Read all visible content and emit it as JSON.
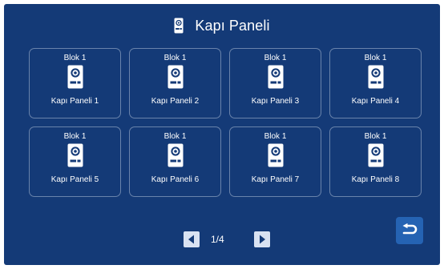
{
  "header": {
    "title": "Kapı Paneli",
    "icon": "door-panel-icon"
  },
  "tiles": [
    {
      "block": "Blok 1",
      "name": "Kapı Paneli 1",
      "icon": "door-panel-icon"
    },
    {
      "block": "Blok 1",
      "name": "Kapı Paneli 2",
      "icon": "door-panel-icon"
    },
    {
      "block": "Blok 1",
      "name": "Kapı Paneli 3",
      "icon": "door-panel-icon"
    },
    {
      "block": "Blok 1",
      "name": "Kapı Paneli 4",
      "icon": "door-panel-icon"
    },
    {
      "block": "Blok 1",
      "name": "Kapı Paneli 5",
      "icon": "door-panel-icon"
    },
    {
      "block": "Blok 1",
      "name": "Kapı Paneli 6",
      "icon": "door-panel-icon"
    },
    {
      "block": "Blok 1",
      "name": "Kapı Paneli 7",
      "icon": "door-panel-icon"
    },
    {
      "block": "Blok 1",
      "name": "Kapı Paneli 8",
      "icon": "door-panel-icon"
    }
  ],
  "pagination": {
    "current_page": "1/4",
    "prev_icon": "chevron-left-icon",
    "next_icon": "chevron-right-icon"
  },
  "back_button": {
    "icon": "back-arrow-icon"
  },
  "colors": {
    "background": "#143a77",
    "tile_border": "#96aac8",
    "back_button": "#2563b3",
    "pager_button": "#d9e2f2",
    "text": "#ffffff"
  }
}
